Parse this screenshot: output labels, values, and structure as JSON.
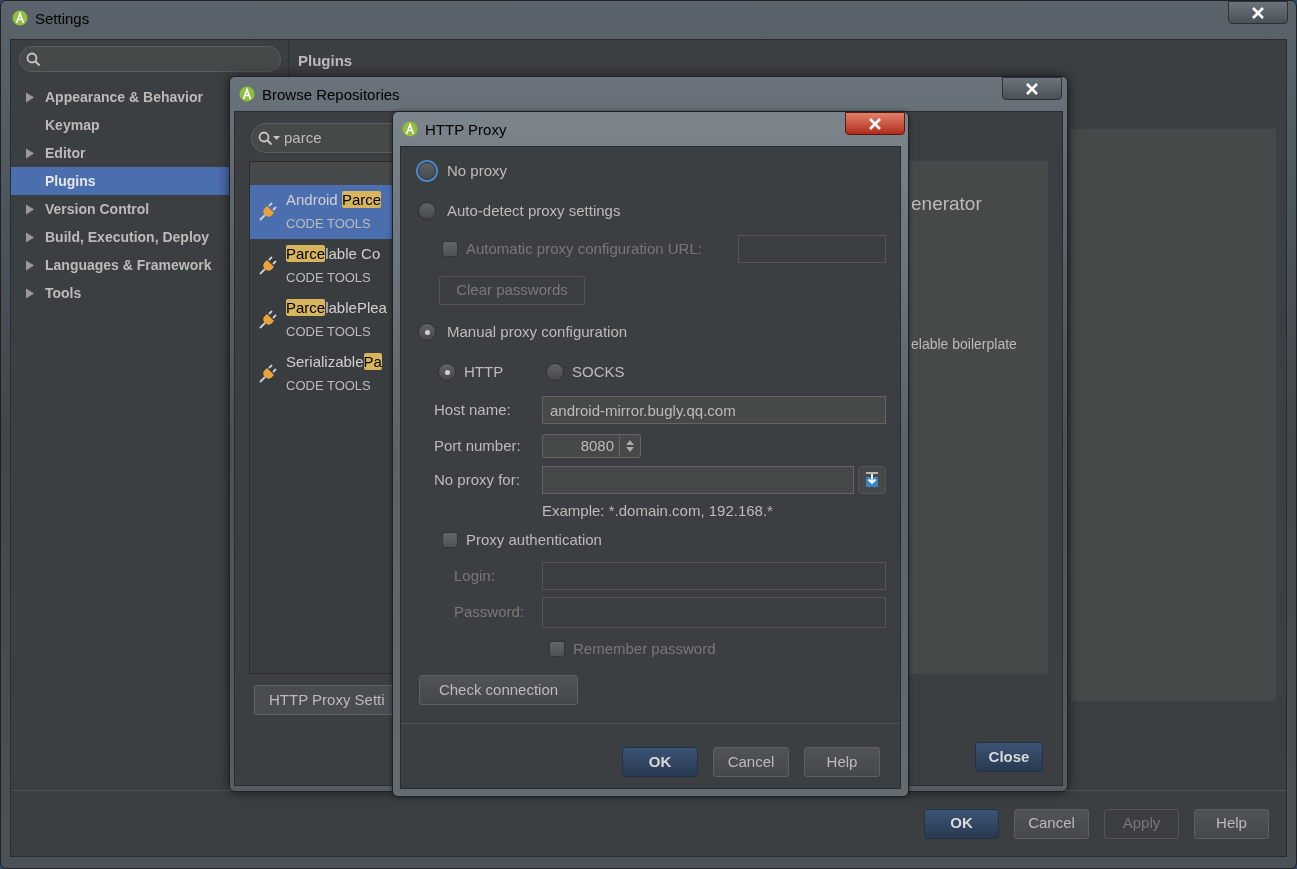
{
  "settings": {
    "title": "Settings",
    "tree": [
      {
        "label": "Appearance & Behavior",
        "expandable": true,
        "selected": false
      },
      {
        "label": "Keymap",
        "expandable": false,
        "selected": false
      },
      {
        "label": "Editor",
        "expandable": true,
        "selected": false
      },
      {
        "label": "Plugins",
        "expandable": false,
        "selected": true
      },
      {
        "label": "Version Control",
        "expandable": true,
        "selected": false
      },
      {
        "label": "Build, Execution, Deploy",
        "expandable": true,
        "selected": false
      },
      {
        "label": "Languages & Framework",
        "expandable": true,
        "selected": false
      },
      {
        "label": "Tools",
        "expandable": true,
        "selected": false
      }
    ],
    "panel_title": "Plugins",
    "buttons": [
      {
        "label": "OK",
        "kind": "default"
      },
      {
        "label": "Cancel",
        "kind": "normal"
      },
      {
        "label": "Apply",
        "kind": "disabled"
      },
      {
        "label": "Help",
        "kind": "normal"
      }
    ]
  },
  "browse": {
    "title": "Browse Repositories",
    "search": {
      "value": "parce"
    },
    "plugins": [
      {
        "name_parts": [
          {
            "text": "Android ",
            "match": false
          },
          {
            "text": "Parce",
            "match": true
          }
        ],
        "category": "CODE TOOLS",
        "selected": true
      },
      {
        "name_parts": [
          {
            "text": "Parce",
            "match": true
          },
          {
            "text": "lable Co",
            "match": false
          }
        ],
        "category": "CODE TOOLS",
        "selected": false
      },
      {
        "name_parts": [
          {
            "text": "Parce",
            "match": true
          },
          {
            "text": "lablePlea",
            "match": false
          }
        ],
        "category": "CODE TOOLS",
        "selected": false
      },
      {
        "name_parts": [
          {
            "text": "Serializable",
            "match": false
          },
          {
            "text": "Pa",
            "match": true
          }
        ],
        "category": "CODE TOOLS",
        "selected": false
      }
    ],
    "detail_title": "enerator",
    "detail_text": "elable boilerplate",
    "proxy_button": "HTTP Proxy Setti",
    "close_button": "Close"
  },
  "proxy": {
    "title": "HTTP Proxy",
    "modes": [
      {
        "label": "No proxy",
        "selected": false,
        "focused": true
      },
      {
        "label": "Auto-detect proxy settings",
        "selected": false,
        "focused": false
      },
      {
        "label": "Manual proxy configuration",
        "selected": true,
        "focused": false
      }
    ],
    "auto_url": {
      "label": "Automatic proxy configuration URL:",
      "checked": false,
      "disabled": true
    },
    "clear_passwords": {
      "label": "Clear passwords",
      "disabled": true
    },
    "protocols": [
      {
        "label": "HTTP",
        "selected": true
      },
      {
        "label": "SOCKS",
        "selected": false
      }
    ],
    "host": {
      "label": "Host name:",
      "value": "android-mirror.bugly.qq.com"
    },
    "port": {
      "label": "Port number:",
      "value": "8080"
    },
    "no_proxy_for": {
      "label": "No proxy for:"
    },
    "example": "Example: *.domain.com, 192.168.*",
    "auth": {
      "label": "Proxy authentication",
      "checked": false
    },
    "login": {
      "label": "Login:",
      "disabled": true
    },
    "password": {
      "label": "Password:",
      "disabled": true
    },
    "remember": {
      "label": "Remember password",
      "checked": false,
      "disabled": true
    },
    "check_button": "Check connection",
    "buttons": [
      {
        "label": "OK",
        "kind": "default"
      },
      {
        "label": "Cancel",
        "kind": "normal"
      },
      {
        "label": "Help",
        "kind": "normal"
      }
    ]
  }
}
